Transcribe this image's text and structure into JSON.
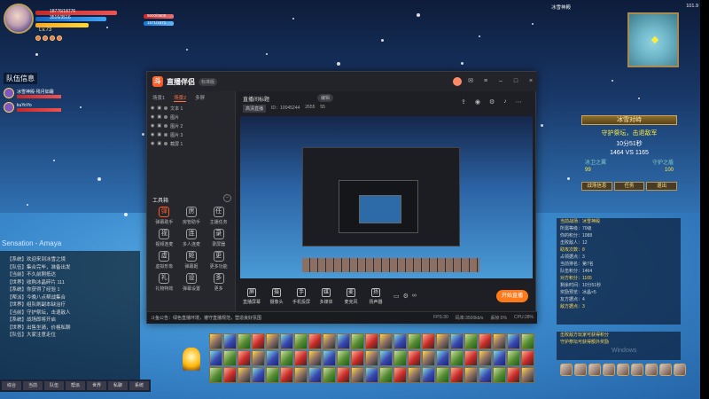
{
  "game": {
    "player": {
      "hp": "18776/18776",
      "mp": "3516/3516",
      "level": "Lv.73"
    },
    "target": {
      "hp": "9600/9600",
      "mp": "1571/1571"
    },
    "team": {
      "title": "队伍信息",
      "members": [
        {
          "name": "冰雪神殿·残月如霜"
        },
        {
          "name": "kuYoYo"
        }
      ]
    },
    "chat": {
      "stream_name": "Sensation - Amaya",
      "lines": [
        "【系统】欢迎来到冰雪之境",
        "【队伍】集合完毕，准备出发",
        "【当前】不久前刚抵达",
        "【世界】收购冰晶碎片 111",
        "【系统】你获得了经验 1",
        "【帮派】今晚八点帮战集合",
        "【世界】组队刷副本缺治疗",
        "【当前】守护祭坛，击退敌人",
        "【系统】战场即将开启",
        "【世界】出售坐骑，价格私聊",
        "【队伍】大家注意走位"
      ],
      "tabs": [
        "综合",
        "当前",
        "队伍",
        "帮派",
        "世界",
        "私聊",
        "系统"
      ]
    },
    "minimap": {
      "location": "冰雪神殿",
      "coords": "101.9"
    },
    "battle": {
      "title": "冰雪对峙",
      "subtitle": "守护祭坛，击退敌军",
      "timer": "10分51秒",
      "score": "1464 VS 1165",
      "left_label": "冰卫之翼",
      "right_label": "守护之盾",
      "left_val": "99",
      "right_val": "100",
      "buttons": [
        "战场信息",
        "任务",
        "退出"
      ]
    },
    "info": {
      "lines": [
        "当前战场：冰雪神殿",
        "所需等级：70级",
        "你的积分：1088",
        "击败敌人：12",
        "助攻次数：8",
        "占领据点：3",
        "当前排名：第7名",
        "队伍积分：1464",
        "对方积分：1165",
        "剩余时间：10分51秒",
        "奖励预览：冰晶×5",
        "友方据点：4",
        "敌方据点：3"
      ],
      "lines2": [
        "击败敌方玩家可获得积分",
        "守护祭坛可获得额外奖励"
      ]
    },
    "activation": "Windows"
  },
  "stream_app": {
    "title": "直播伴侣",
    "version": "标准版",
    "window_controls": [
      "min",
      "max",
      "close"
    ],
    "tabs": [
      "场景1",
      "场景2",
      "多屏"
    ],
    "scenes": [
      "文本 1",
      "图片",
      "图片 2",
      "图片 3",
      "截屏 1"
    ],
    "tools_title": "工具箱",
    "tools": [
      {
        "label": "弹幕助手",
        "icon": "弹",
        "hot": true
      },
      {
        "label": "房管助手",
        "icon": "房",
        "hot": false
      },
      {
        "label": "主播任务",
        "icon": "任",
        "hot": false
      },
      {
        "label": "视频连麦",
        "icon": "视",
        "hot": false
      },
      {
        "label": "多人连麦",
        "icon": "连",
        "hot": false
      },
      {
        "label": "录屏器",
        "icon": "录",
        "hot": false
      },
      {
        "label": "虚拟形象",
        "icon": "虚",
        "hot": false
      },
      {
        "label": "弹幕姬",
        "icon": "姬",
        "hot": false
      },
      {
        "label": "更多功能",
        "icon": "更",
        "hot": false
      },
      {
        "label": "礼物特效",
        "icon": "礼",
        "hot": false
      },
      {
        "label": "弹幕设置",
        "icon": "设",
        "hot": false
      },
      {
        "label": "更多",
        "icon": "多",
        "hot": false
      }
    ],
    "room": {
      "title": "直播间标题",
      "edit": "编辑",
      "quality": "高清直播",
      "id": "ID：10045244",
      "viewers": "2655",
      "likes": "55"
    },
    "top_icons": [
      "分享",
      "录制",
      "设置",
      "通知",
      "更多"
    ],
    "controls": [
      {
        "label": "直播屏幕",
        "icon": "屏"
      },
      {
        "label": "摄像头",
        "icon": "摄"
      },
      {
        "label": "手机投屏",
        "icon": "手"
      },
      {
        "label": "多媒体",
        "icon": "媒"
      },
      {
        "label": "麦克风",
        "icon": "麦"
      },
      {
        "label": "扬声器",
        "icon": "扬"
      }
    ],
    "start_label": "开始直播",
    "status": {
      "notice": "斗鱼公告：绿色直播环境，遵守直播规范，营造良好氛围",
      "fps": "FPS:30",
      "bitrate": "码率:3500kb/s",
      "drop": "丢帧:0%",
      "cpu": "CPU:28%"
    }
  }
}
